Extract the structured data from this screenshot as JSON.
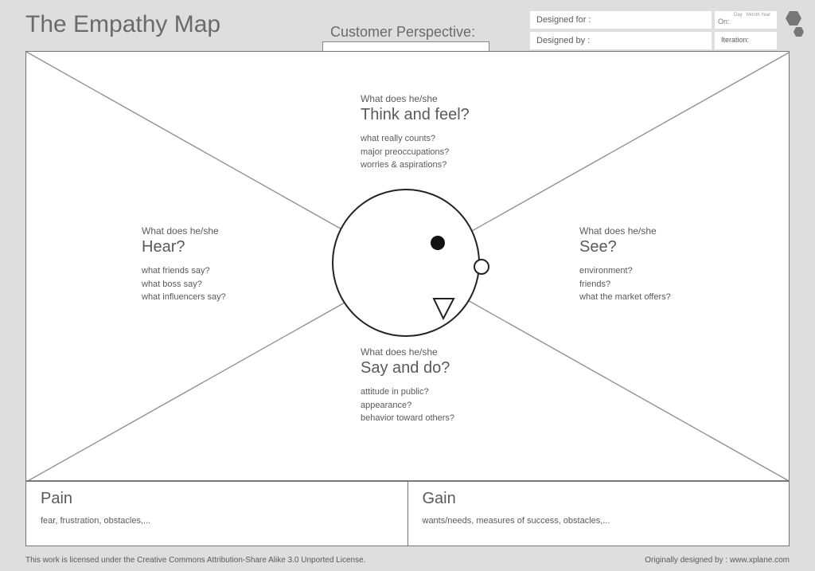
{
  "title": "The Empathy Map",
  "subtitle": "Customer Perspective:",
  "meta": {
    "designed_for_label": "Designed for :",
    "designed_by_label": "Designed by :",
    "on_label": "On:",
    "day_label": "Day",
    "month_label": "Month",
    "year_label": "Year",
    "iteration_label": "Iteration:"
  },
  "quadrants": {
    "think": {
      "lead": "What does he/she",
      "heading": "Think and feel?",
      "p1": "what really counts?",
      "p2": "major preoccupations?",
      "p3": "worries & aspirations?"
    },
    "hear": {
      "lead": "What does he/she",
      "heading": "Hear?",
      "p1": "what friends say?",
      "p2": "what boss say?",
      "p3": "what influencers say?"
    },
    "see": {
      "lead": "What does he/she",
      "heading": "See?",
      "p1": "environment?",
      "p2": "friends?",
      "p3": "what the market offers?"
    },
    "say": {
      "lead": "What does he/she",
      "heading": "Say and do?",
      "p1": "attitude in public?",
      "p2": "appearance?",
      "p3": "behavior toward others?"
    }
  },
  "pain": {
    "heading": "Pain",
    "prompt": "fear, frustration, obstacles,..."
  },
  "gain": {
    "heading": "Gain",
    "prompt": "wants/needs, measures of success, obstacles,..."
  },
  "footer": {
    "license": "This work is licensed under the Creative Commons Attribution-Share Alike 3.0 Unported License.",
    "credit": "Originally designed by : www.xplane.com"
  }
}
